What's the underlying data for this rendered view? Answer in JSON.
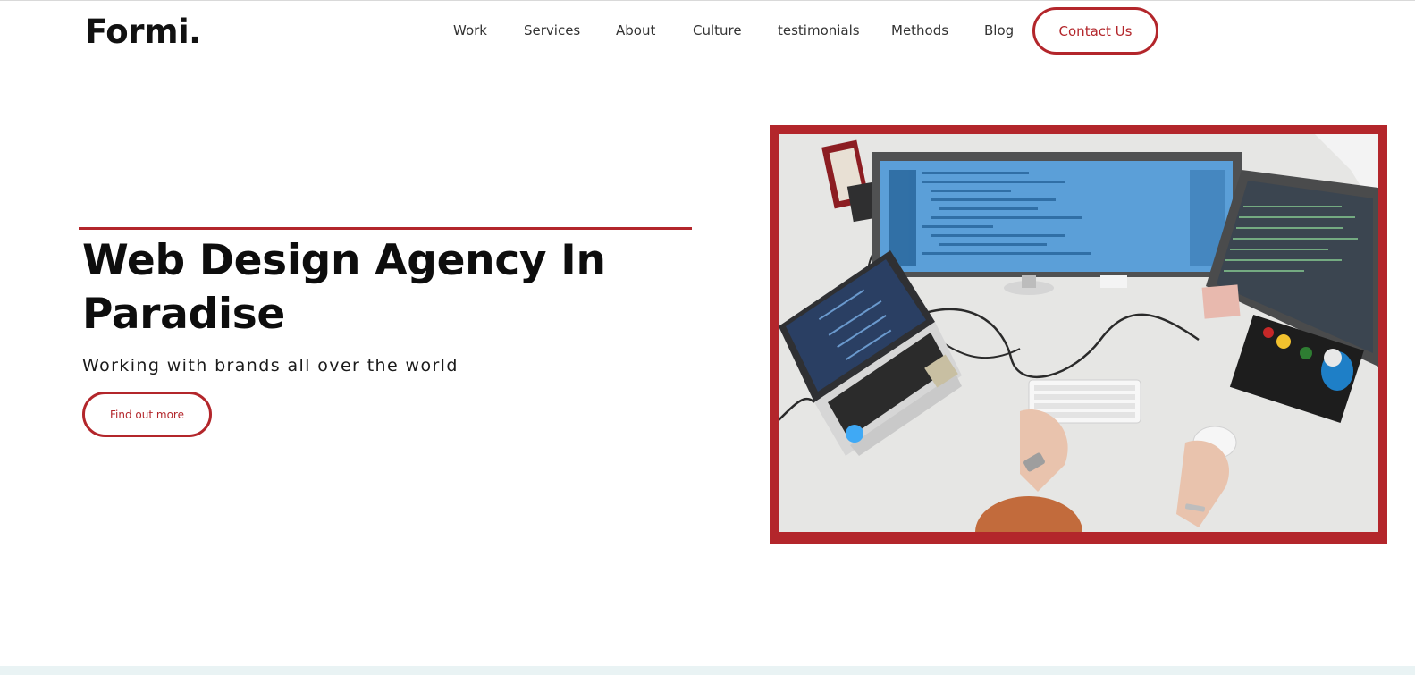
{
  "brand": {
    "logo": "Formi."
  },
  "nav": {
    "items": [
      {
        "label": "Work"
      },
      {
        "label": "Services"
      },
      {
        "label": "About"
      },
      {
        "label": "Culture"
      },
      {
        "label": "testimonials"
      },
      {
        "label": "Methods"
      },
      {
        "label": "Blog"
      }
    ],
    "contact_label": "Contact Us"
  },
  "hero": {
    "title": "Web Design Agency In Paradise",
    "subtitle": "Working with brands all over the world",
    "cta_label": "Find out more"
  },
  "colors": {
    "accent": "#b3262b",
    "text": "#111111",
    "background": "#ffffff"
  },
  "image": {
    "icon": "desk-workspace-photo"
  }
}
